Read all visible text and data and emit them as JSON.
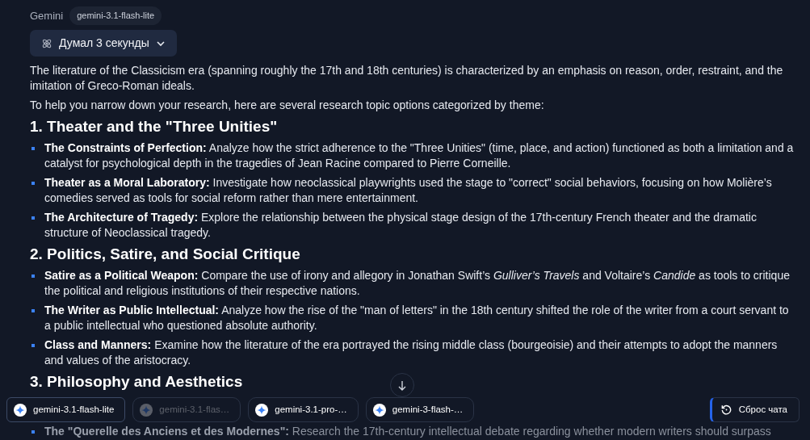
{
  "header": {
    "provider": "Gemini",
    "model_badge": "gemini-3.1-flash-lite"
  },
  "thinking": {
    "label": "Думал 3 секунды",
    "expanded": false
  },
  "intro": [
    "The literature of the Classicism era (spanning roughly the 17th and 18th centuries) is characterized by an emphasis on reason, order, restraint, and the imitation of Greco-Roman ideals.",
    "To help you narrow down your research, here are several research topic options categorized by theme:"
  ],
  "sections": [
    {
      "heading": "1. Theater and the \"Three Unities\"",
      "items": [
        "**The Constraints of Perfection:** Analyze how the strict adherence to the \"Three Unities\" (time, place, and action) functioned as both a limitation and a catalyst for psychological depth in the tragedies of Jean Racine compared to Pierre Corneille.",
        "**Theater as a Moral Laboratory:** Investigate how neoclassical playwrights used the stage to \"correct\" social behaviors, focusing on how Molière’s comedies served as tools for social reform rather than mere entertainment.",
        "**The Architecture of Tragedy:** Explore the relationship between the physical stage design of the 17th-century French theater and the dramatic structure of Neoclassical tragedy."
      ]
    },
    {
      "heading": "2. Politics, Satire, and Social Critique",
      "items": [
        "**Satire as a Political Weapon:** Compare the use of irony and allegory in Jonathan Swift’s *Gulliver’s Travels* and Voltaire’s *Candide* as tools to critique the political and religious institutions of their respective nations.",
        "**The Writer as Public Intellectual:** Analyze how the rise of the \"man of letters\" in the 18th century shifted the role of the writer from a court servant to a public intellectual who questioned absolute authority.",
        "**Class and Manners:** Examine how the literature of the era portrayed the rising middle class (bourgeoisie) and their attempts to adopt the manners and values of the aristocracy."
      ]
    },
    {
      "heading": "3. Philosophy and Aesthetics",
      "items": [
        "**The \"Querelle des Anciens et des Modernes\":** Research the 17th-century intellectual debate regarding whether modern writers should surpass"
      ]
    }
  ],
  "model_chips": [
    {
      "label": "gemini-3.1-flash-lite",
      "selected": true,
      "disabled": false
    },
    {
      "label": "gemini-3.1-flas…",
      "selected": false,
      "disabled": true
    },
    {
      "label": "gemini-3.1-pro-…",
      "selected": false,
      "disabled": false
    },
    {
      "label": "gemini-3-flash-…",
      "selected": false,
      "disabled": false
    }
  ],
  "reset_button": {
    "label": "Сброс чата"
  }
}
